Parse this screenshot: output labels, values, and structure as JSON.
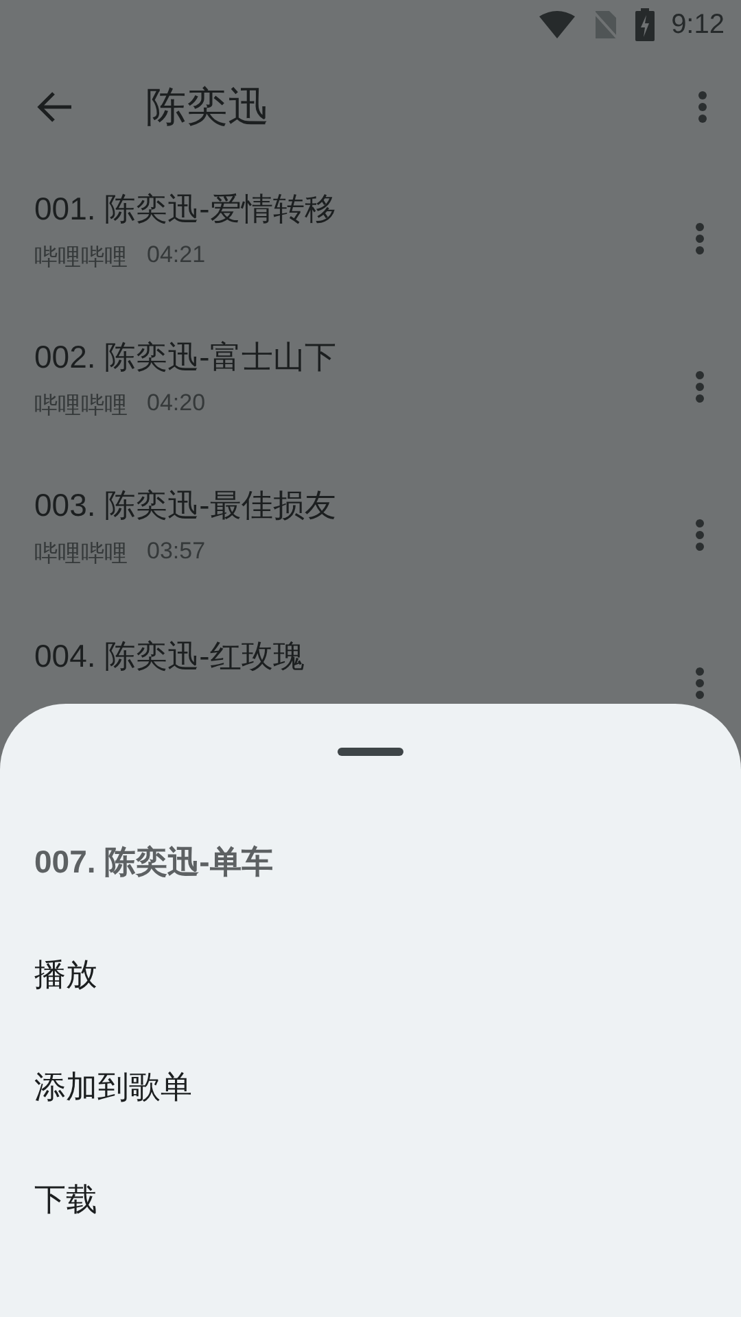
{
  "status_bar": {
    "time": "9:12"
  },
  "app_bar": {
    "title": "陈奕迅"
  },
  "songs": [
    {
      "title": "001. 陈奕迅-爱情转移",
      "source": "哔哩哔哩",
      "duration": "04:21"
    },
    {
      "title": "002. 陈奕迅-富士山下",
      "source": "哔哩哔哩",
      "duration": "04:20"
    },
    {
      "title": "003. 陈奕迅-最佳损友",
      "source": "哔哩哔哩",
      "duration": "03:57"
    },
    {
      "title": "004. 陈奕迅-红玫瑰"
    }
  ],
  "bottom_sheet": {
    "title": "007. 陈奕迅-单车",
    "actions": [
      "播放",
      "添加到歌单",
      "下载"
    ]
  }
}
